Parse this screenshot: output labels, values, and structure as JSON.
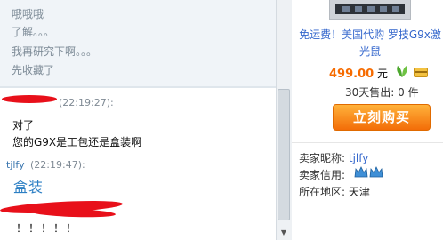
{
  "chat": {
    "history": [
      "哦哦哦",
      "了解。。。",
      "我再研究下啊。。。",
      "先收藏了"
    ],
    "messages": [
      {
        "header": "(22:19:27):",
        "lines": [
          "对了",
          "您的G9X是工包还是盒装啊"
        ]
      },
      {
        "sender": "tjlfy",
        "header": "(22:19:47):",
        "lines": [
          "盒装"
        ]
      },
      {
        "lines": [
          "！！！！！"
        ]
      }
    ]
  },
  "product": {
    "title": "免运费！美国代购 罗技G9x激光鼠",
    "price": "499.00",
    "price_unit": "元",
    "sold_label": "30天售出:",
    "sold_count": "0 件",
    "buy_label": "立刻购买",
    "seller": [
      {
        "label": "卖家昵称:",
        "value": "tjlfy"
      },
      {
        "label": "卖家信用:",
        "value": ""
      },
      {
        "label": "所在地区:",
        "value": "天津"
      }
    ]
  },
  "colors": {
    "link": "#3366cc",
    "price": "#f66b00",
    "buy_button": "#f36d08",
    "redaction": "#e8101a"
  }
}
